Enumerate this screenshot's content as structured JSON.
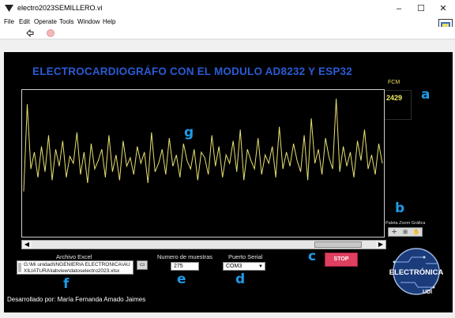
{
  "window": {
    "title": "electro2023SEMILLERO.vi",
    "minimize": "–",
    "maximize": "☐",
    "close": "✕"
  },
  "menu": [
    "File",
    "Edit",
    "Operate",
    "Tools",
    "Window",
    "Help"
  ],
  "toolbar": {
    "run_icon": "run-arrow-icon",
    "stop_icon": "abort-icon"
  },
  "panel": {
    "title": "ELECTROCARDIOGRÁFO CON EL MODULO AD8232 Y ESP32",
    "fcm": {
      "label": "FCM",
      "value": "2429"
    },
    "callouts": {
      "a": "a",
      "b": "b",
      "c": "c",
      "d": "d",
      "e": "e",
      "f": "f",
      "g": "g"
    },
    "zoom_label": "Paleta Zoom Gráfica",
    "excel": {
      "label": "Archivo Excel",
      "path": "G:\\Mi unidad\\INGENIERIA ELECTRONICA\\AUXILIATURA\\labview\\datoselectro2023.xlsx"
    },
    "samples": {
      "label": "Numero de muestras",
      "value": "275"
    },
    "serial": {
      "label": "Puerto Serial",
      "value": "COM3"
    },
    "stop": {
      "label": "STOP"
    },
    "footer": "Desarrollado por: María Fernanda Amado Jaimes",
    "logo": {
      "line1": "ELECTRÓNICA",
      "line2": "UDI"
    }
  },
  "colors": {
    "panel_bg": "#000000",
    "title": "#2a5bd6",
    "trace": "#e8e070",
    "callout": "#1f9be8",
    "stop": "#e04060"
  },
  "chart_data": {
    "type": "line",
    "series": [
      {
        "values": [
          30,
          92,
          46,
          58,
          40,
          62,
          44,
          70,
          38,
          60,
          48,
          66,
          40,
          55,
          50,
          72,
          42,
          58,
          36,
          64,
          46,
          52,
          60,
          40,
          70,
          44,
          56,
          38,
          66,
          48,
          54,
          42,
          62,
          50,
          58,
          36,
          72,
          44,
          50,
          60,
          42,
          68,
          48,
          56,
          40,
          64,
          52,
          46,
          60,
          38,
          58,
          54,
          42,
          70,
          48,
          62,
          40,
          56,
          50,
          66,
          44,
          74,
          38,
          60,
          52,
          46,
          68,
          42,
          56,
          50,
          62,
          40,
          76,
          46,
          58,
          48,
          64,
          52,
          44,
          70,
          38,
          82,
          50,
          60,
          42,
          68,
          54,
          46,
          96,
          44,
          62,
          48,
          58,
          40,
          66,
          52,
          74,
          46,
          56,
          42,
          64,
          50
        ]
      }
    ]
  }
}
